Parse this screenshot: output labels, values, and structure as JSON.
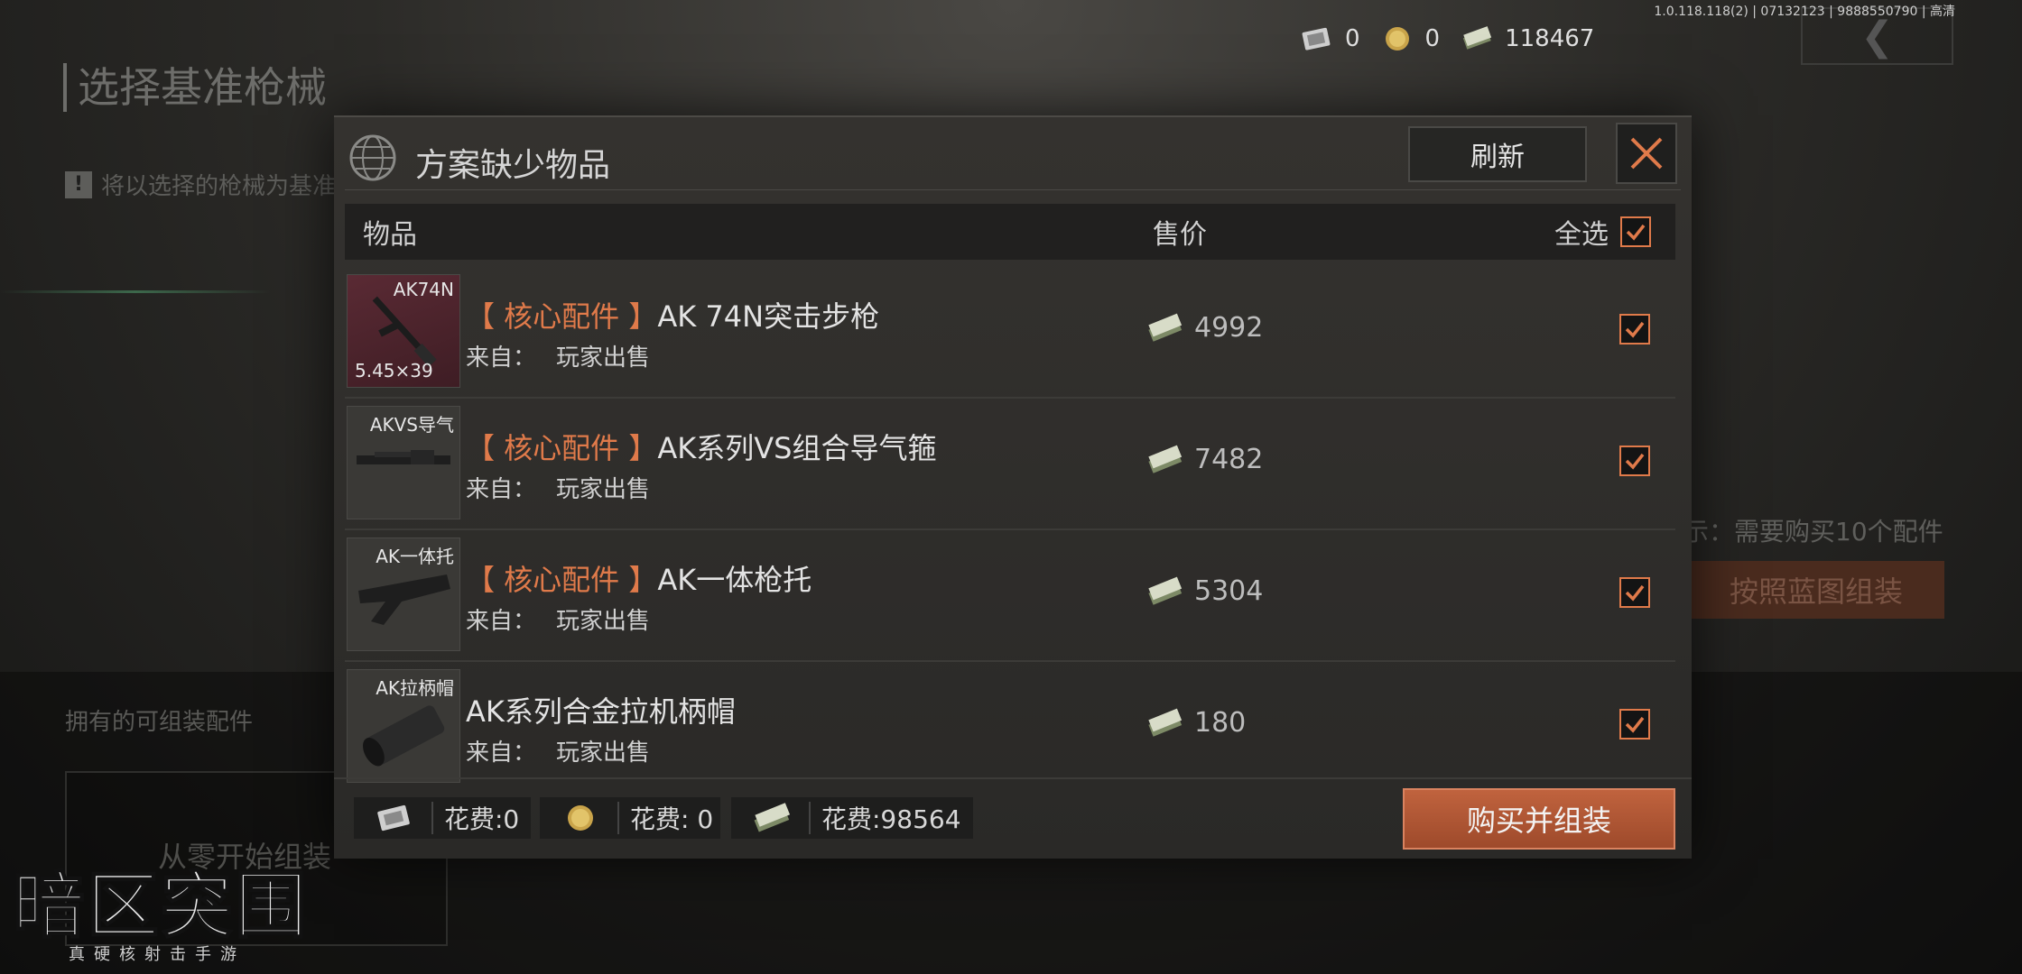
{
  "background": {
    "screen_title": "选择基准枪械",
    "hint": "将以选择的枪械为基准",
    "owned_section": "拥有的可组装配件",
    "scratch_button": "从零开始组装",
    "right_tip": "示：需要购买10个配件",
    "blueprint_button": "按照蓝图组装"
  },
  "version": "1.0.118.118(2) | 07132123 | 9888550790 | 高清",
  "currency": {
    "ticket": "0",
    "coin": "0",
    "cash": "118467"
  },
  "dialog": {
    "title": "方案缺少物品",
    "refresh_label": "刷新",
    "columns": {
      "item": "物品",
      "price": "售价",
      "select_all": "全选"
    },
    "select_all_checked": true,
    "rows": [
      {
        "code": "AK74N",
        "caliber": "5.45×39",
        "tag": "【 核心配件 】",
        "name": "AK 74N突击步枪",
        "from_label": "来自：",
        "from_value": "玩家出售",
        "price": "4992",
        "checked": true
      },
      {
        "code": "AKVS导气",
        "caliber": "",
        "tag": "【 核心配件 】",
        "name": "AK系列VS组合导气箍",
        "from_label": "来自：",
        "from_value": "玩家出售",
        "price": "7482",
        "checked": true
      },
      {
        "code": "AK一体托",
        "caliber": "",
        "tag": "【 核心配件 】",
        "name": "AK一体枪托",
        "from_label": "来自：",
        "from_value": "玩家出售",
        "price": "5304",
        "checked": true
      },
      {
        "code": "AK拉柄帽",
        "caliber": "",
        "tag": "",
        "name": "AK系列合金拉机柄帽",
        "from_label": "来自：",
        "from_value": "玩家出售",
        "price": "180",
        "checked": true
      }
    ],
    "costs": {
      "ticket": "花费:0",
      "coin": "花费: 0",
      "cash": "花费:98564"
    },
    "buy_label": "购买并组装"
  },
  "logo": {
    "main": "暗区突围",
    "sub": "真硬核射击手游"
  },
  "colors": {
    "accent": "#e07a4a",
    "buy_button": "#b05a38",
    "panel": "#2f2e2b"
  }
}
